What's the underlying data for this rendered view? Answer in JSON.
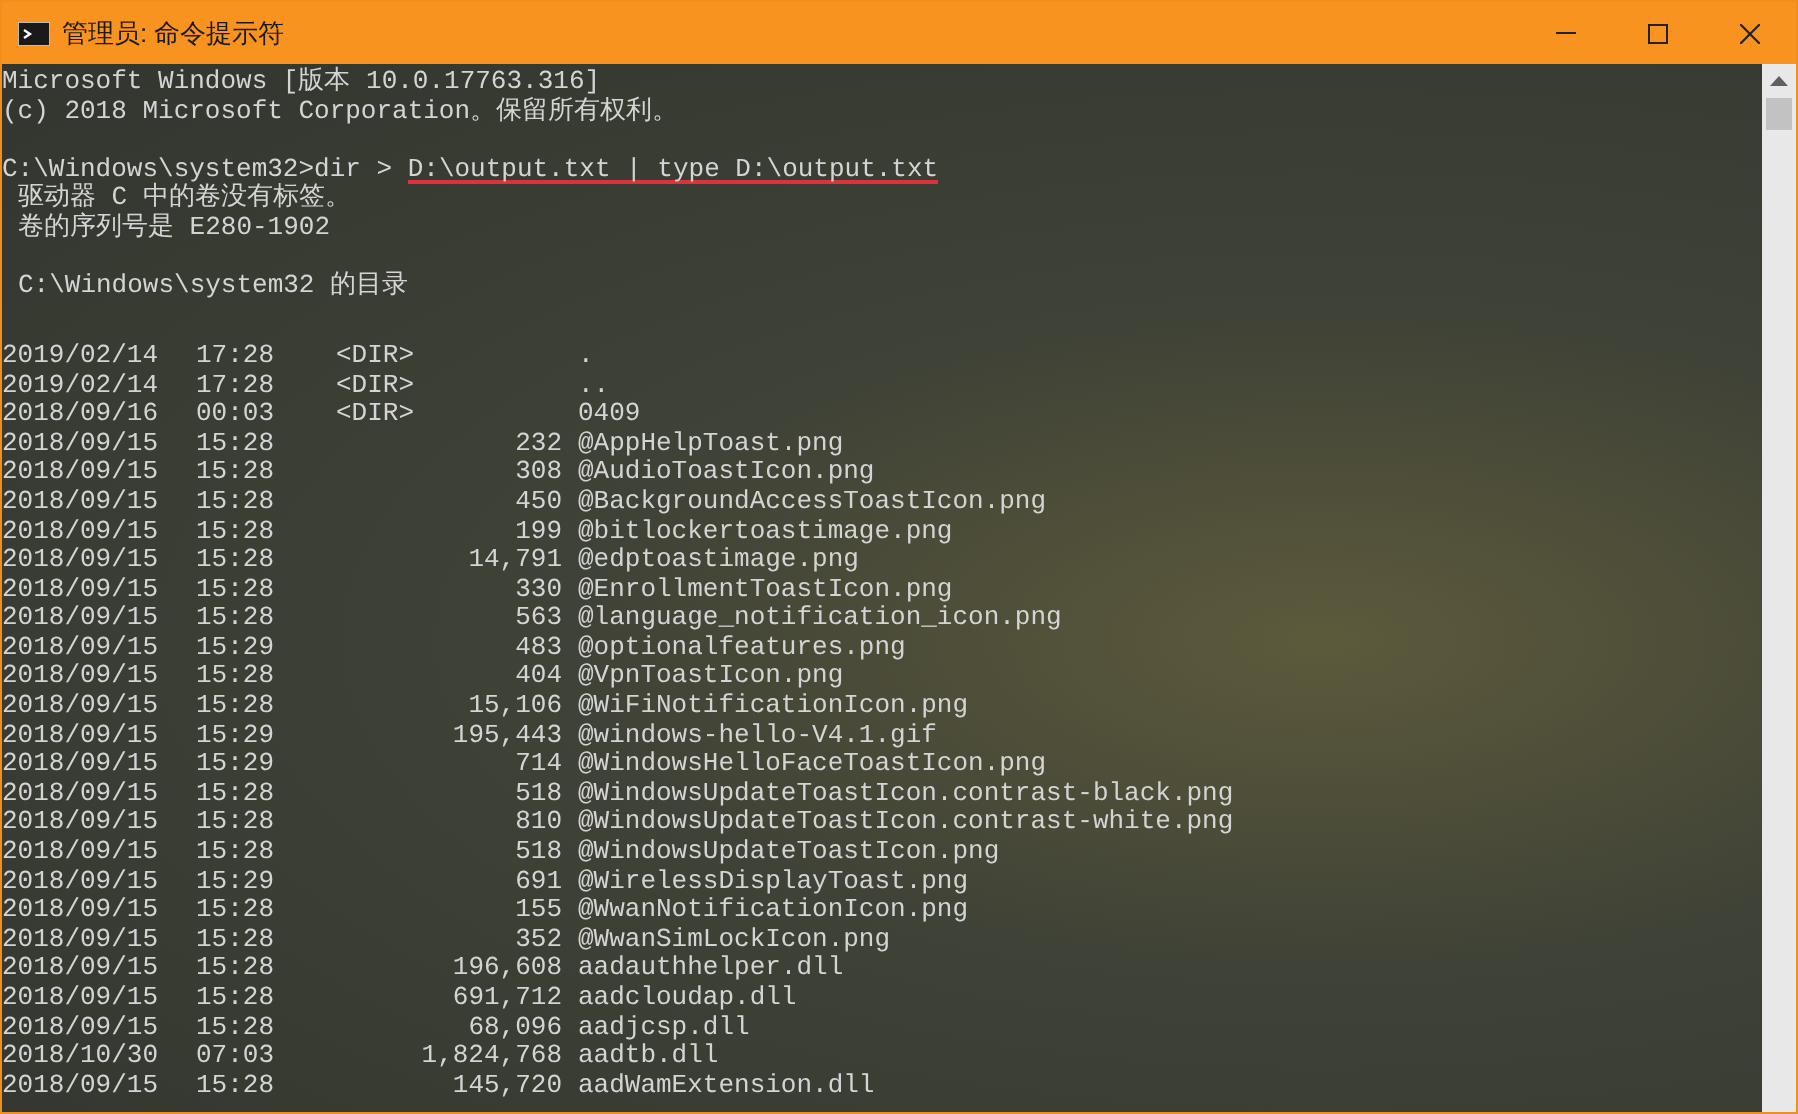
{
  "window": {
    "title": "管理员: 命令提示符"
  },
  "console": {
    "banner": [
      "Microsoft Windows [版本 10.0.17763.316]",
      "(c) 2018 Microsoft Corporation。保留所有权利。"
    ],
    "command": [
      {
        "text": "C:\\Windows\\system32>dir > ",
        "underlined": false
      },
      {
        "text": "D:\\output.txt | type D:\\output.txt",
        "underlined": true
      }
    ],
    "volume_info": [
      "驱动器 C 中的卷没有标签。",
      "卷的序列号是 E280-1902"
    ],
    "directory_heading": "C:\\Windows\\system32 的目录",
    "listing": [
      {
        "date": "2019/02/14",
        "time": "17:28",
        "kind": "dir",
        "size": "<DIR>",
        "name": "."
      },
      {
        "date": "2019/02/14",
        "time": "17:28",
        "kind": "dir",
        "size": "<DIR>",
        "name": ".."
      },
      {
        "date": "2018/09/16",
        "time": "00:03",
        "kind": "dir",
        "size": "<DIR>",
        "name": "0409"
      },
      {
        "date": "2018/09/15",
        "time": "15:28",
        "kind": "file",
        "size": "232",
        "name": "@AppHelpToast.png"
      },
      {
        "date": "2018/09/15",
        "time": "15:28",
        "kind": "file",
        "size": "308",
        "name": "@AudioToastIcon.png"
      },
      {
        "date": "2018/09/15",
        "time": "15:28",
        "kind": "file",
        "size": "450",
        "name": "@BackgroundAccessToastIcon.png"
      },
      {
        "date": "2018/09/15",
        "time": "15:28",
        "kind": "file",
        "size": "199",
        "name": "@bitlockertoastimage.png"
      },
      {
        "date": "2018/09/15",
        "time": "15:28",
        "kind": "file",
        "size": "14,791",
        "name": "@edptoastimage.png"
      },
      {
        "date": "2018/09/15",
        "time": "15:28",
        "kind": "file",
        "size": "330",
        "name": "@EnrollmentToastIcon.png"
      },
      {
        "date": "2018/09/15",
        "time": "15:28",
        "kind": "file",
        "size": "563",
        "name": "@language_notification_icon.png"
      },
      {
        "date": "2018/09/15",
        "time": "15:29",
        "kind": "file",
        "size": "483",
        "name": "@optionalfeatures.png"
      },
      {
        "date": "2018/09/15",
        "time": "15:28",
        "kind": "file",
        "size": "404",
        "name": "@VpnToastIcon.png"
      },
      {
        "date": "2018/09/15",
        "time": "15:28",
        "kind": "file",
        "size": "15,106",
        "name": "@WiFiNotificationIcon.png"
      },
      {
        "date": "2018/09/15",
        "time": "15:29",
        "kind": "file",
        "size": "195,443",
        "name": "@windows-hello-V4.1.gif"
      },
      {
        "date": "2018/09/15",
        "time": "15:29",
        "kind": "file",
        "size": "714",
        "name": "@WindowsHelloFaceToastIcon.png"
      },
      {
        "date": "2018/09/15",
        "time": "15:28",
        "kind": "file",
        "size": "518",
        "name": "@WindowsUpdateToastIcon.contrast-black.png"
      },
      {
        "date": "2018/09/15",
        "time": "15:28",
        "kind": "file",
        "size": "810",
        "name": "@WindowsUpdateToastIcon.contrast-white.png"
      },
      {
        "date": "2018/09/15",
        "time": "15:28",
        "kind": "file",
        "size": "518",
        "name": "@WindowsUpdateToastIcon.png"
      },
      {
        "date": "2018/09/15",
        "time": "15:29",
        "kind": "file",
        "size": "691",
        "name": "@WirelessDisplayToast.png"
      },
      {
        "date": "2018/09/15",
        "time": "15:28",
        "kind": "file",
        "size": "155",
        "name": "@WwanNotificationIcon.png"
      },
      {
        "date": "2018/09/15",
        "time": "15:28",
        "kind": "file",
        "size": "352",
        "name": "@WwanSimLockIcon.png"
      },
      {
        "date": "2018/09/15",
        "time": "15:28",
        "kind": "file",
        "size": "196,608",
        "name": "aadauthhelper.dll"
      },
      {
        "date": "2018/09/15",
        "time": "15:28",
        "kind": "file",
        "size": "691,712",
        "name": "aadcloudap.dll"
      },
      {
        "date": "2018/09/15",
        "time": "15:28",
        "kind": "file",
        "size": "68,096",
        "name": "aadjcsp.dll"
      },
      {
        "date": "2018/10/30",
        "time": "07:03",
        "kind": "file",
        "size": "1,824,768",
        "name": "aadtb.dll"
      },
      {
        "date": "2018/09/15",
        "time": "15:28",
        "kind": "file",
        "size": "145,720",
        "name": "aadWamExtension.dll"
      }
    ]
  }
}
